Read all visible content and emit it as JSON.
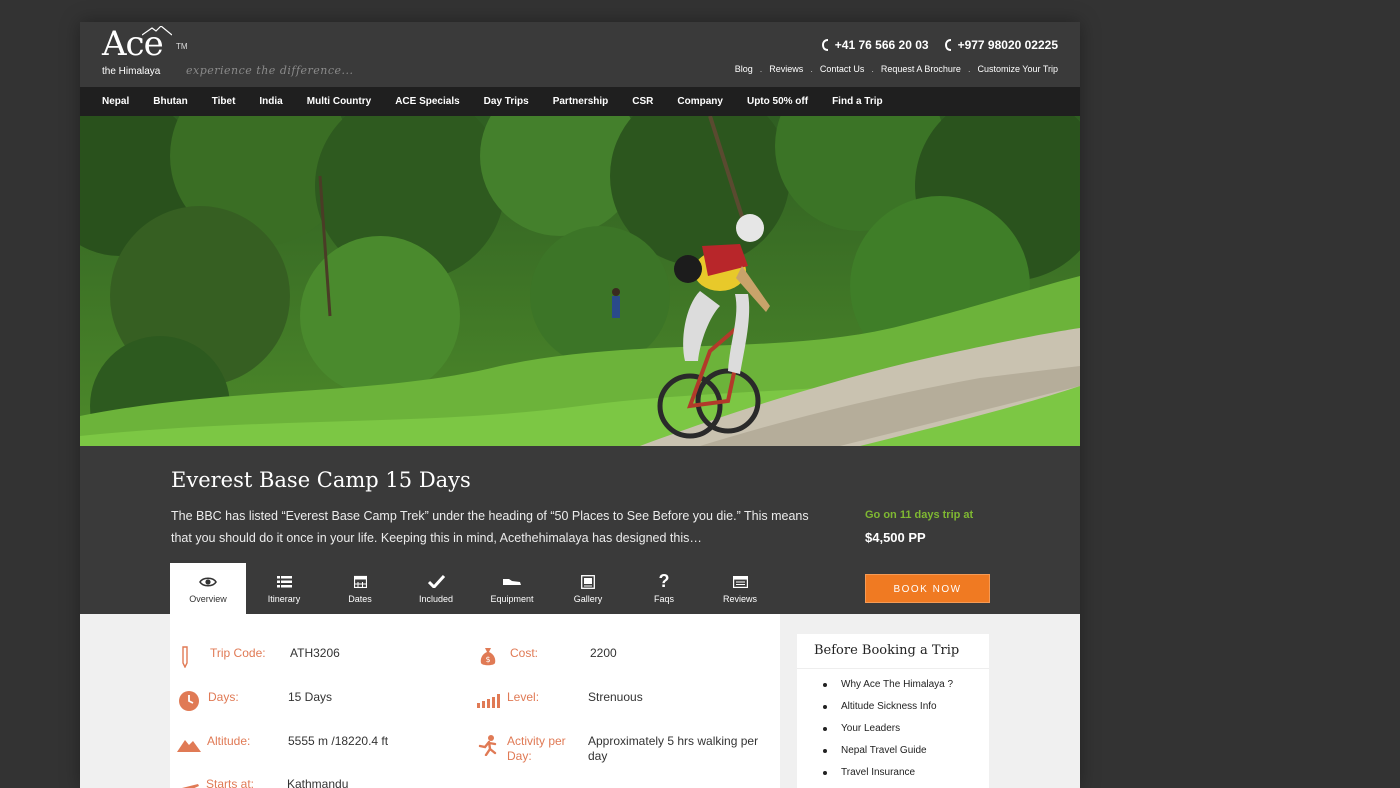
{
  "logo": {
    "name": "Ace",
    "tm": "TM",
    "sub": "the Himalaya"
  },
  "tagline": "experience the difference...",
  "phones": [
    "+41 76 566 20 03",
    "+977 98020 02225"
  ],
  "top_links": [
    "Blog",
    "Reviews",
    "Contact Us",
    "Request A Brochure",
    "Customize Your Trip"
  ],
  "nav": [
    "Nepal",
    "Bhutan",
    "Tibet",
    "India",
    "Multi Country",
    "ACE Specials",
    "Day Trips",
    "Partnership",
    "CSR",
    "Company",
    "Upto 50% off",
    "Find a Trip"
  ],
  "trip": {
    "title": "Everest Base Camp 15 Days",
    "description": "The BBC has listed “Everest Base Camp Trek” under the heading of “50 Places to See Before you die.” This means that you should do it once in your life. Keeping this in mind, Acethehimalaya has designed this…",
    "go_on": "Go on 11 days trip at",
    "price": "$4,500 PP",
    "book_label": "BOOK NOW"
  },
  "tabs": [
    {
      "label": "Overview",
      "icon": "eye-icon"
    },
    {
      "label": "Itinerary",
      "icon": "list-icon"
    },
    {
      "label": "Dates",
      "icon": "calendar-icon"
    },
    {
      "label": "Included",
      "icon": "check-icon"
    },
    {
      "label": "Equipment",
      "icon": "shoe-icon"
    },
    {
      "label": "Gallery",
      "icon": "image-icon"
    },
    {
      "label": "Faqs",
      "icon": "question-icon"
    },
    {
      "label": "Reviews",
      "icon": "review-icon"
    }
  ],
  "facts": {
    "trip_code": {
      "label": "Trip Code:",
      "value": "ATH3206"
    },
    "days": {
      "label": "Days:",
      "value": "15 Days"
    },
    "altitude": {
      "label": "Altitude:",
      "value": "5555 m /18220.4 ft"
    },
    "starts_at": {
      "label": "Starts at:",
      "value": "Kathmandu"
    },
    "cost": {
      "label": "Cost:",
      "value": "2200"
    },
    "level": {
      "label": "Level:",
      "value": "Strenuous"
    },
    "activity": {
      "label": "Activity per Day:",
      "value": "Approximately 5 hrs walking per day"
    }
  },
  "sidebar": {
    "title": "Before Booking a Trip",
    "items": [
      "Why Ace The Himalaya ?",
      "Altitude Sickness Info",
      "Your Leaders",
      "Nepal Travel Guide",
      "Travel Insurance"
    ]
  },
  "colors": {
    "accent": "#f07a22",
    "label": "#e07a55",
    "green": "#7fb832",
    "nav_bg": "#1f1f1f",
    "page_bg": "#3a3a3a"
  }
}
